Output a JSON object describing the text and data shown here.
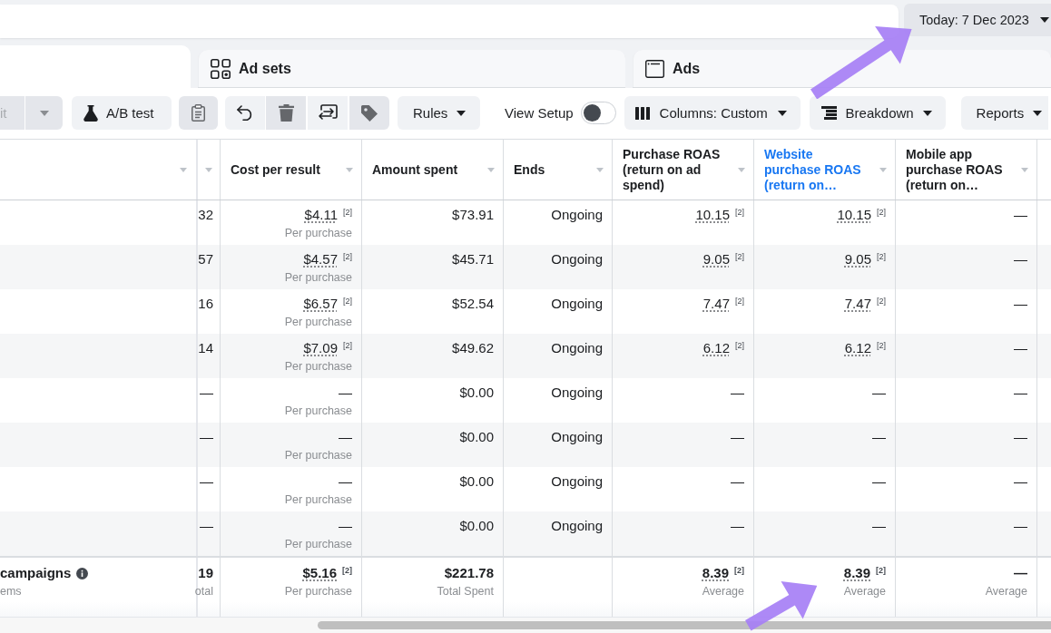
{
  "date_range": {
    "label": "Today: 7 Dec 2023"
  },
  "tabs": [
    {
      "selected": true
    },
    {
      "label": "Ad sets",
      "selected": false
    },
    {
      "label": "Ads",
      "selected": false
    }
  ],
  "toolbar": {
    "edit": {
      "label": "it",
      "disabled": true
    },
    "ab_test": {
      "label": "A/B test",
      "disabled": false
    },
    "clipboard": {
      "disabled": true
    },
    "actions": [
      {
        "disabled": false
      },
      {
        "disabled": true
      },
      {
        "disabled": false
      },
      {
        "disabled": true
      }
    ],
    "rules": {
      "label": "Rules"
    },
    "view_setup": {
      "label": "View Setup",
      "on": false
    },
    "columns": {
      "label": "Columns: Custom"
    },
    "breakdown": {
      "label": "Breakdown"
    },
    "reports": {
      "label": "Reports"
    }
  },
  "table": {
    "columns": [
      {
        "kind": "name",
        "total": {
          "title": "campaigns",
          "subtitle": "ems"
        }
      },
      {
        "kind": "metric",
        "cells": [
          {
            "value": "32"
          },
          {
            "value": "57"
          },
          {
            "value": "16"
          },
          {
            "value": "14"
          },
          {
            "value": "—"
          },
          {
            "value": "—"
          },
          {
            "value": "—"
          },
          {
            "value": "—"
          }
        ],
        "total": {
          "value": "19",
          "caption": "otal"
        }
      },
      {
        "kind": "metric",
        "label": "Cost per result",
        "highlighted": false,
        "cells": [
          {
            "value": "$4.11",
            "footnote": "[2]",
            "caption": "Per purchase"
          },
          {
            "value": "$4.57",
            "footnote": "[2]",
            "caption": "Per purchase"
          },
          {
            "value": "$6.57",
            "footnote": "[2]",
            "caption": "Per purchase"
          },
          {
            "value": "$7.09",
            "footnote": "[2]",
            "caption": "Per purchase"
          },
          {
            "value": "—",
            "caption": "Per purchase"
          },
          {
            "value": "—",
            "caption": "Per purchase"
          },
          {
            "value": "—",
            "caption": "Per purchase"
          },
          {
            "value": "—",
            "caption": "Per purchase"
          }
        ],
        "total": {
          "value": "$5.16",
          "footnote": "[2]",
          "caption": "Per purchase"
        }
      },
      {
        "kind": "metric",
        "label": "Amount spent",
        "highlighted": false,
        "cells": [
          {
            "value": "$73.91"
          },
          {
            "value": "$45.71"
          },
          {
            "value": "$52.54"
          },
          {
            "value": "$49.62"
          },
          {
            "value": "$0.00"
          },
          {
            "value": "$0.00"
          },
          {
            "value": "$0.00"
          },
          {
            "value": "$0.00"
          }
        ],
        "total": {
          "value": "$221.78",
          "caption": "Total Spent"
        }
      },
      {
        "kind": "metric",
        "label": "Ends",
        "highlighted": false,
        "cells": [
          {
            "value": "Ongoing"
          },
          {
            "value": "Ongoing"
          },
          {
            "value": "Ongoing"
          },
          {
            "value": "Ongoing"
          },
          {
            "value": "Ongoing"
          },
          {
            "value": "Ongoing"
          },
          {
            "value": "Ongoing"
          },
          {
            "value": "Ongoing"
          }
        ]
      },
      {
        "kind": "metric",
        "label": "Purchase ROAS (return on ad spend)",
        "highlighted": false,
        "cells": [
          {
            "value": "10.15",
            "footnote": "[2]"
          },
          {
            "value": "9.05",
            "footnote": "[2]"
          },
          {
            "value": "7.47",
            "footnote": "[2]"
          },
          {
            "value": "6.12",
            "footnote": "[2]"
          },
          {
            "value": "—"
          },
          {
            "value": "—"
          },
          {
            "value": "—"
          },
          {
            "value": "—"
          }
        ],
        "total": {
          "value": "8.39",
          "footnote": "[2]",
          "caption": "Average"
        }
      },
      {
        "kind": "metric",
        "label": "Website purchase ROAS (return on…",
        "highlighted": true,
        "cells": [
          {
            "value": "10.15",
            "footnote": "[2]"
          },
          {
            "value": "9.05",
            "footnote": "[2]"
          },
          {
            "value": "7.47",
            "footnote": "[2]"
          },
          {
            "value": "6.12",
            "footnote": "[2]"
          },
          {
            "value": "—"
          },
          {
            "value": "—"
          },
          {
            "value": "—"
          },
          {
            "value": "—"
          }
        ],
        "total": {
          "value": "8.39",
          "footnote": "[2]",
          "caption": "Average"
        }
      },
      {
        "kind": "metric",
        "label": "Mobile app purchase ROAS (return on…",
        "highlighted": false,
        "cells": [
          {
            "value": "—"
          },
          {
            "value": "—"
          },
          {
            "value": "—"
          },
          {
            "value": "—"
          },
          {
            "value": "—"
          },
          {
            "value": "—"
          },
          {
            "value": "—"
          },
          {
            "value": "—"
          }
        ],
        "total": {
          "value": "—",
          "caption": "Average"
        }
      }
    ]
  }
}
